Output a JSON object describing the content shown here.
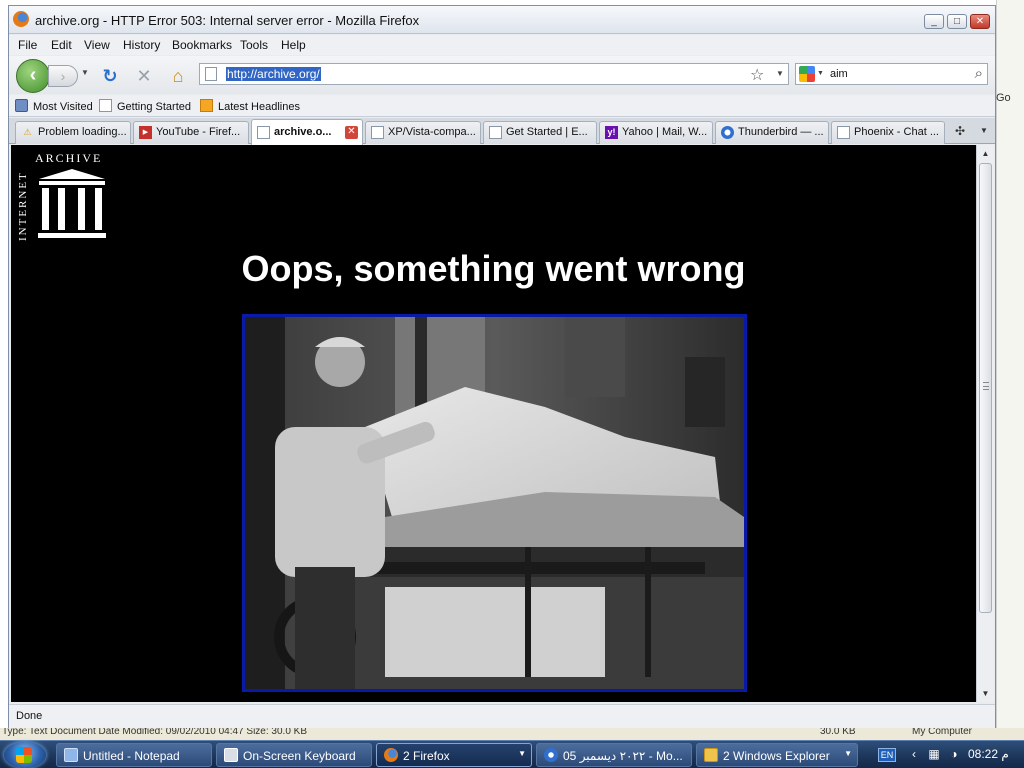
{
  "window": {
    "title": "archive.org - HTTP Error 503: Internal server error - Mozilla Firefox",
    "controls": {
      "minimize": "_",
      "maximize": "□",
      "close": "✕"
    }
  },
  "menu": [
    "File",
    "Edit",
    "View",
    "History",
    "Bookmarks",
    "Tools",
    "Help"
  ],
  "nav": {
    "url": "http://archive.org/",
    "search_value": "aim",
    "back_icon": "back-arrow-icon",
    "forward_icon": "forward-arrow-icon",
    "reload_icon": "reload-icon",
    "stop_icon": "stop-icon",
    "home_icon": "home-icon"
  },
  "bookmarks": [
    "Most Visited",
    "Getting Started",
    "Latest Headlines"
  ],
  "tabs": [
    {
      "label": "Problem loading...",
      "icon": "warning-icon"
    },
    {
      "label": "YouTube - Firef...",
      "icon": "youtube-icon"
    },
    {
      "label": "archive.o...",
      "icon": "page-icon",
      "active": true
    },
    {
      "label": "XP/Vista-compa...",
      "icon": "page-icon"
    },
    {
      "label": "Get Started | E...",
      "icon": "page-icon"
    },
    {
      "label": "Yahoo | Mail, W...",
      "icon": "yahoo-icon"
    },
    {
      "label": "Thunderbird — ...",
      "icon": "thunderbird-icon"
    },
    {
      "label": "Phoenix - Chat ...",
      "icon": "page-icon"
    }
  ],
  "page": {
    "logo_text_top": "ARCHIVE",
    "logo_text_side": "INTERNET",
    "heading": "Oops, something went wrong",
    "photo_alt": "black-and-white photo of a man operating a machine"
  },
  "status": "Done",
  "background": {
    "go_label": "Go",
    "bottom_left": "Type: Text Document Date Modified: 09/02/2010 04:47 Size: 30.0 KB",
    "bottom_mid": "30.0 KB",
    "bottom_right": "My Computer"
  },
  "taskbar": {
    "items": [
      {
        "label": "Untitled - Notepad"
      },
      {
        "label": "On-Screen Keyboard"
      },
      {
        "label": "2 Firefox",
        "active": true
      },
      {
        "label": "05 ٢٠٢٢ ديسمبر - Mo..."
      },
      {
        "label": "2 Windows Explorer"
      }
    ],
    "lang": "EN",
    "clock": "08:22 م"
  }
}
